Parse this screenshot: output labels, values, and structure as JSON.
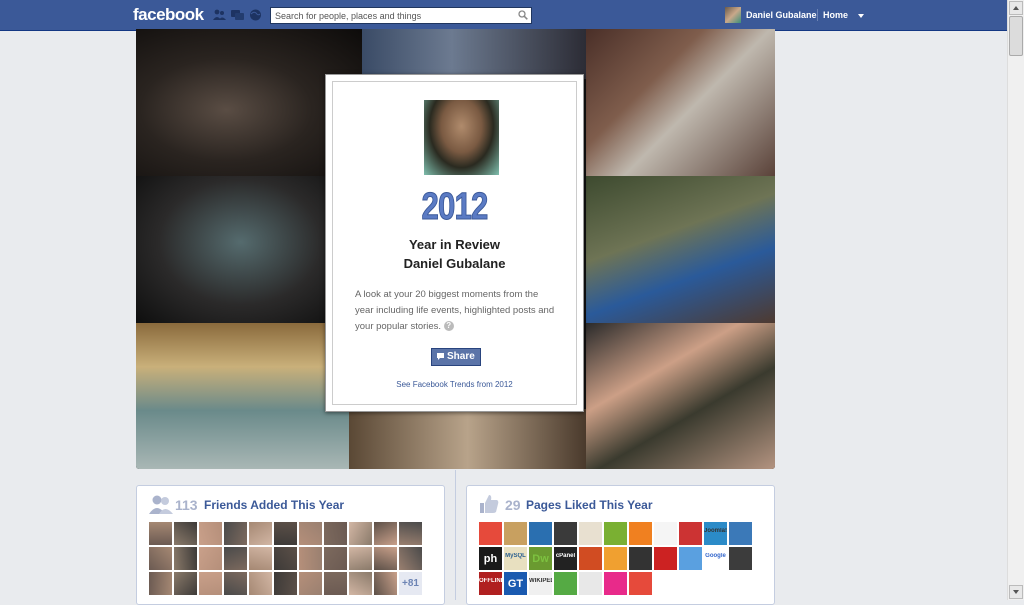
{
  "topbar": {
    "logo": "facebook",
    "search_placeholder": "Search for people, places and things",
    "user_name": "Daniel Gubalane",
    "home_label": "Home",
    "accent_color": "#3b5998"
  },
  "review_card": {
    "year": "2012",
    "title": "Year in Review",
    "name": "Daniel Gubalane",
    "description": "A look at your 20 biggest moments from the year including life events, highlighted posts and your popular stories.",
    "share_label": "Share",
    "trends_link": "See Facebook Trends from 2012"
  },
  "friends_panel": {
    "count": "113",
    "title": "Friends Added This Year",
    "more_label": "+81",
    "icon": "friends-icon"
  },
  "pages_panel": {
    "count": "29",
    "title": "Pages Liked This Year",
    "icon": "thumbs-up-icon",
    "thumb_labels": [
      "ph",
      "MySQL",
      "Dw",
      "cPanel",
      "Joomla!",
      "Google",
      "OFFLINE",
      "GT",
      "WIKIPEDIA"
    ]
  }
}
